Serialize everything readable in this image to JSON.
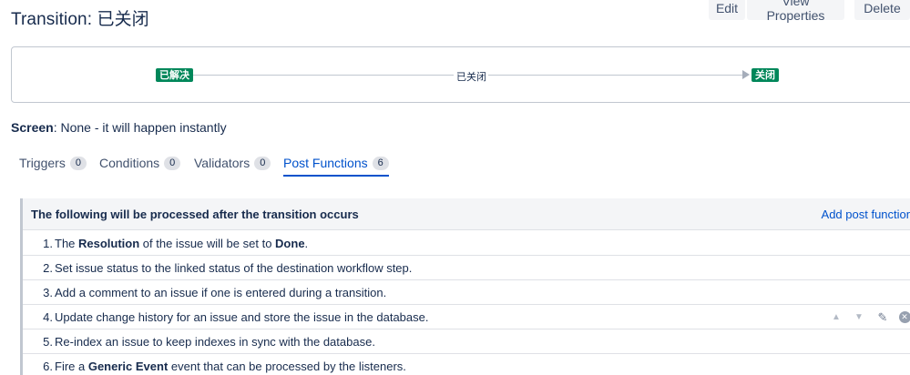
{
  "header": {
    "title_prefix": "Transition: ",
    "title_name": "已关闭"
  },
  "toolbar": {
    "edit_label": "Edit",
    "view_properties_label": "View Properties",
    "delete_label": "Delete"
  },
  "diagram": {
    "from_status": "已解决",
    "transition_name": "已关闭",
    "to_status": "关闭",
    "status_color": "#00875a"
  },
  "screen": {
    "label": "Screen",
    "value": ": None - it will happen instantly"
  },
  "tabs": [
    {
      "label": "Triggers",
      "count": "0"
    },
    {
      "label": "Conditions",
      "count": "0"
    },
    {
      "label": "Validators",
      "count": "0"
    },
    {
      "label": "Post Functions",
      "count": "6",
      "active": true
    }
  ],
  "panel": {
    "heading": "The following will be processed after the transition occurs",
    "add_link": "Add post function",
    "rows": [
      {
        "num": "1.",
        "parts": [
          "The ",
          "Resolution",
          " of the issue will be set to ",
          "Done",
          "."
        ]
      },
      {
        "num": "2.",
        "text": "Set issue status to the linked status of the destination workflow step."
      },
      {
        "num": "3.",
        "text": "Add a comment to an issue if one is entered during a transition."
      },
      {
        "num": "4.",
        "text": "Update change history for an issue and store the issue in the database."
      },
      {
        "num": "5.",
        "text": "Re-index an issue to keep indexes in sync with the database."
      },
      {
        "num": "6.",
        "parts": [
          "Fire a ",
          "Generic Event",
          " event that can be processed by the listeners."
        ]
      }
    ],
    "row_action_icons": [
      "arrow-up-icon",
      "arrow-down-icon",
      "pencil-icon",
      "remove-icon"
    ]
  },
  "colors": {
    "accent": "#0052cc",
    "status_done": "#00875a",
    "text": "#172b4d"
  }
}
